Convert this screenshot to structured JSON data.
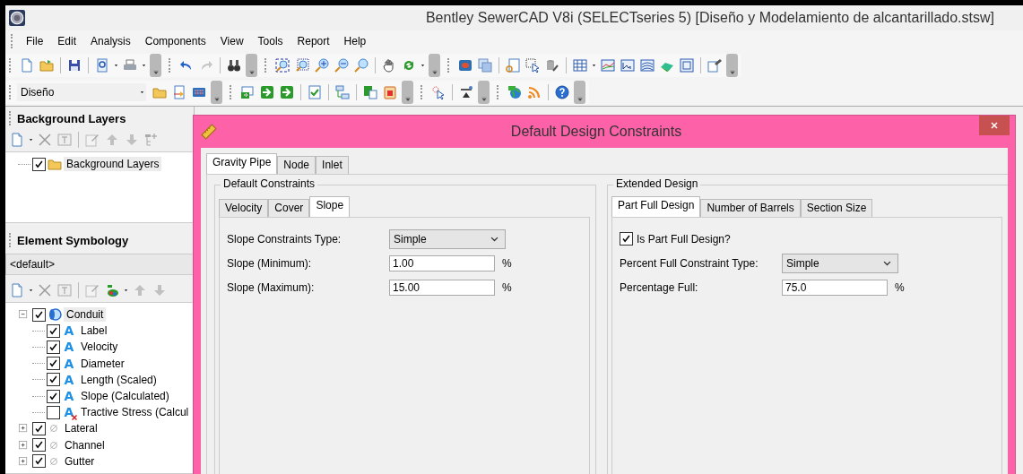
{
  "window": {
    "title": "Bentley SewerCAD V8i (SELECTseries 5) [Diseño y Modelamiento de alcantarillado.stsw]"
  },
  "menu": [
    "File",
    "Edit",
    "Analysis",
    "Components",
    "View",
    "Tools",
    "Report",
    "Help"
  ],
  "scenario_combo": {
    "value": "Diseño"
  },
  "background_layers": {
    "title": "Background Layers",
    "items": [
      {
        "label": "Background Layers",
        "checked": true,
        "selected": true
      }
    ]
  },
  "element_symbology": {
    "title": "Element Symbology",
    "selector": "<default>",
    "tree": [
      {
        "label": "Conduit",
        "checked": true,
        "expanded": true,
        "selected": true,
        "children": [
          {
            "label": "Label",
            "glyph": "A",
            "checked": true
          },
          {
            "label": "Velocity",
            "glyph": "A",
            "checked": true
          },
          {
            "label": "Diameter",
            "glyph": "A",
            "checked": true
          },
          {
            "label": "Length (Scaled)",
            "glyph": "A",
            "checked": true
          },
          {
            "label": "Slope (Calculated)",
            "glyph": "A",
            "checked": true
          },
          {
            "label": "Tractive Stress (Calcul",
            "glyph": "A",
            "checked": false
          }
        ]
      },
      {
        "label": "Lateral",
        "checked": true,
        "expanded": false,
        "selected": false
      },
      {
        "label": "Channel",
        "checked": true,
        "expanded": false,
        "selected": false
      },
      {
        "label": "Gutter",
        "checked": true,
        "expanded": false,
        "selected": false
      }
    ]
  },
  "dialog": {
    "title": "Default Design Constraints",
    "tabs": [
      {
        "label": "Gravity Pipe",
        "selected": true
      },
      {
        "label": "Node",
        "selected": false
      },
      {
        "label": "Inlet",
        "selected": false
      }
    ],
    "groups": [
      {
        "title": "Default Constraints",
        "tabs": [
          {
            "label": "Velocity",
            "selected": false
          },
          {
            "label": "Cover",
            "selected": false
          },
          {
            "label": "Slope",
            "selected": true
          }
        ],
        "fields": [
          {
            "kind": "select",
            "label": "Slope Constraints Type:",
            "value": "Simple"
          },
          {
            "kind": "input",
            "label": "Slope (Minimum):",
            "value": "1.00",
            "unit": "%"
          },
          {
            "kind": "input",
            "label": "Slope (Maximum):",
            "value": "15.00",
            "unit": "%"
          }
        ]
      },
      {
        "title": "Extended Design",
        "tabs": [
          {
            "label": "Part Full Design",
            "selected": true
          },
          {
            "label": "Number of Barrels",
            "selected": false
          },
          {
            "label": "Section Size",
            "selected": false
          }
        ],
        "fields": [
          {
            "kind": "checkbox",
            "label": "Is Part Full Design?",
            "checked": true
          },
          {
            "kind": "select",
            "label": "Percent Full Constraint Type:",
            "value": "Simple"
          },
          {
            "kind": "input",
            "label": "Percentage Full:",
            "value": "75.0",
            "unit": "%"
          }
        ]
      }
    ]
  }
}
